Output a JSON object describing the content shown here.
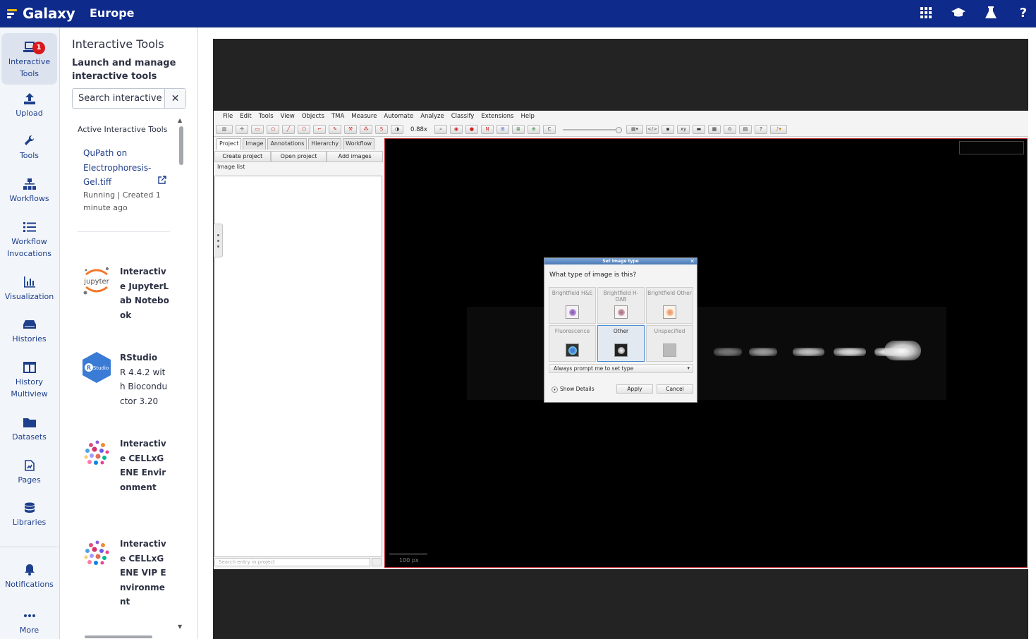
{
  "header": {
    "brand": "Galaxy",
    "subtitle": "Europe",
    "icons": [
      "apps-grid-icon",
      "graduation-cap-icon",
      "flask-icon",
      "help-icon"
    ]
  },
  "activity": {
    "items": [
      {
        "label": "Interactive Tools",
        "icon": "laptop-icon",
        "badge": "1",
        "active": true
      },
      {
        "label": "Upload",
        "icon": "upload-icon"
      },
      {
        "label": "Tools",
        "icon": "wrench-icon"
      },
      {
        "label": "Workflows",
        "icon": "sitemap-icon"
      },
      {
        "label": "Workflow Invocations",
        "icon": "list-icon"
      },
      {
        "label": "Visualization",
        "icon": "chart-icon"
      },
      {
        "label": "Histories",
        "icon": "drive-icon"
      },
      {
        "label": "History Multiview",
        "icon": "columns-icon"
      },
      {
        "label": "Datasets",
        "icon": "folder-icon"
      },
      {
        "label": "Pages",
        "icon": "file-chart-icon"
      },
      {
        "label": "Libraries",
        "icon": "database-icon"
      },
      {
        "label": "Notifications",
        "icon": "bell-icon"
      },
      {
        "label": "More",
        "icon": "ellipsis-icon"
      }
    ]
  },
  "panel": {
    "title": "Interactive Tools",
    "subtitle": "Launch and manage interactive tools",
    "search_value": "Search interactive",
    "active_heading": "Active Interactive Tools",
    "active_tool": {
      "name": "QuPath on Electrophoresis-Gel.tiff",
      "status": "Running | Created 1 minute ago"
    },
    "tools": [
      {
        "name": "Interactive JupyterLab Notebook",
        "logo": "jupyter-logo"
      },
      {
        "name": "RStudio",
        "detail": "R 4.4.2 with Bioconductor 3.20",
        "logo": "rstudio-logo"
      },
      {
        "name": "Interactive CELLxGENE Environment",
        "logo": "cellxgene-logo"
      },
      {
        "name": "Interactive CELLxGENE VIP Environment",
        "logo": "cellxgene-vip-logo"
      }
    ]
  },
  "qupath": {
    "menus": [
      "File",
      "Edit",
      "Tools",
      "View",
      "Objects",
      "TMA",
      "Measure",
      "Automate",
      "Analyze",
      "Classify",
      "Extensions",
      "Help"
    ],
    "zoom": "0.88x",
    "tabs": [
      "Project",
      "Image",
      "Annotations",
      "Hierarchy",
      "Workflow"
    ],
    "buttons": [
      "Create project",
      "Open project",
      "Add images"
    ],
    "list_header": "Image list",
    "search_placeholder": "Search entry in project",
    "scale_label": "100 px",
    "dialog": {
      "title": "Set image type",
      "question": "What type of image is this?",
      "options": [
        {
          "label": "Brightfield H&E",
          "selected": false
        },
        {
          "label": "Brightfield H-DAB",
          "selected": false
        },
        {
          "label": "Brightfield Other",
          "selected": false
        },
        {
          "label": "Fluorescence",
          "selected": false
        },
        {
          "label": "Other",
          "selected": true
        },
        {
          "label": "Unspecified",
          "selected": false
        }
      ],
      "prompt_option": "Always prompt me to set type",
      "show_details": "Show Details",
      "apply": "Apply",
      "cancel": "Cancel"
    }
  }
}
